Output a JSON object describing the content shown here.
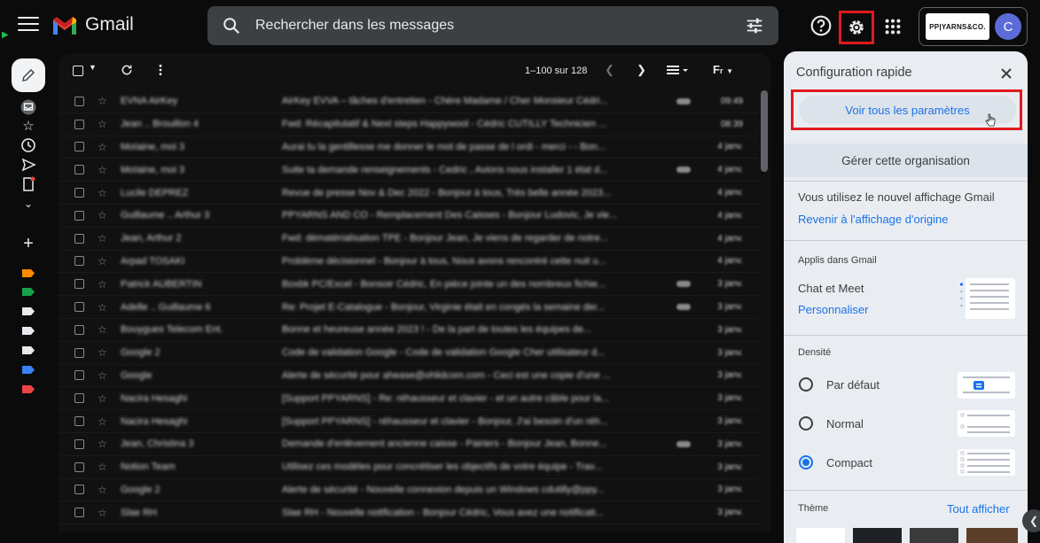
{
  "app": {
    "name": "Gmail"
  },
  "search": {
    "placeholder": "Rechercher dans les messages"
  },
  "account": {
    "org_logo_text": "PP|YARNS&CO.",
    "avatar_letter": "C"
  },
  "toolbar": {
    "pager": "1–100 sur 128"
  },
  "emails": [
    {
      "sender": "EVNA AirKey",
      "subject": "AirKey EVVA – tâches d'entretien - Chère Madame / Cher Monsieur Cédri...",
      "date": "09:49",
      "attach": true
    },
    {
      "sender": "Jean .. Brouillon 4",
      "subject": "Fwd: Récapitulatif & Next steps Happywool - Cédric CUTILLY Technicien ...",
      "date": "08:39",
      "attach": false
    },
    {
      "sender": "Moïaine, moi 3",
      "subject": "Aurai tu la gentillesse me donner le mot de passe de l ordi - merci - - Bon...",
      "date": "4 janv.",
      "attach": false
    },
    {
      "sender": "Moïaine, moi 3",
      "subject": "Suite ta demande renseignements - Cedric , Avions nous installer 1 état d...",
      "date": "4 janv.",
      "attach": true
    },
    {
      "sender": "Lucile DEPREZ",
      "subject": "Revue de presse Nov & Dec 2022 - Bonjour à tous, Très belle année 2023...",
      "date": "4 janv.",
      "attach": false
    },
    {
      "sender": "Guillaume .. Arthur 3",
      "subject": "PPYARNS AND CO - Remplacement Des Caisses - Bonjour Ludovic, Je vie...",
      "date": "4 janv.",
      "attach": false
    },
    {
      "sender": "Jean, Arthur 2",
      "subject": "Fwd: dématérialisation TPE - Bonjour Jean, Je viens de regarder de notre...",
      "date": "4 janv.",
      "attach": false
    },
    {
      "sender": "Arpad TOSAKI",
      "subject": "Problème décisionnel - Bonjour à tous, Nous avons rencontré cette nuit u...",
      "date": "4 janv.",
      "attach": false
    },
    {
      "sender": "Patrick AUBERTIN",
      "subject": "Boxbk PC/Excel - Bonsoir Cédric, En pièce jointe un des nombreux fichie...",
      "date": "3 janv.",
      "attach": true
    },
    {
      "sender": "Adelle .. Guillaume 6",
      "subject": "Re: Projet E-Catalogue - Bonjour, Virginie était en congés la semaine der...",
      "date": "3 janv.",
      "attach": true
    },
    {
      "sender": "Bouygues Telecom Ent.",
      "subject": "Bonne et heureuse année 2023 ! - De la part de toutes les équipes de...",
      "date": "3 janv.",
      "attach": false
    },
    {
      "sender": "Google 2",
      "subject": "Code de validation Google - Code de validation Google Cher utilisateur d...",
      "date": "3 janv.",
      "attach": false
    },
    {
      "sender": "Google",
      "subject": "Alerte de sécurité pour ahease@ohlidcom.com - Ceci est une copie d'une ...",
      "date": "3 janv.",
      "attach": false
    },
    {
      "sender": "Nacira Hesaghi",
      "subject": "[Support PPYARNS] - Re: réhausseur et clavier - et un autre câble pour la...",
      "date": "3 janv.",
      "attach": false
    },
    {
      "sender": "Nacira Hesaghi",
      "subject": "[Support PPYARNS] - réhausseur et clavier - Bonjour, J'ai besoin d'un réh...",
      "date": "3 janv.",
      "attach": false
    },
    {
      "sender": "Jean, Christina 3",
      "subject": "Demande d'enlèvement ancienne caisse - Pairiers - Bonjour Jean, Bonne...",
      "date": "3 janv.",
      "attach": true
    },
    {
      "sender": "Notion Team",
      "subject": "Utilisez ces modèles pour concrétiser les objectifs de votre équipe - Trav...",
      "date": "3 janv.",
      "attach": false
    },
    {
      "sender": "Google 2",
      "subject": "Alerte de sécurité - Nouvelle connexion depuis un Windows cdutilly@ppy...",
      "date": "3 janv.",
      "attach": false
    },
    {
      "sender": "Slae RH",
      "subject": "Slae RH - Nouvelle notification - Bonjour Cédric, Vous avez une notificati...",
      "date": "3 janv.",
      "attach": false
    }
  ],
  "panel": {
    "title": "Configuration rapide",
    "all_settings": "Voir tous les paramètres",
    "manage_org": "Gérer cette organisation",
    "new_view_text": "Vous utilisez le nouvel affichage Gmail",
    "revert_link": "Revenir à l'affichage d'origine",
    "apps_section": "Applis dans Gmail",
    "chat_meet": "Chat et Meet",
    "customize_link": "Personnaliser",
    "density_section": "Densité",
    "density_default": "Par défaut",
    "density_normal": "Normal",
    "density_compact": "Compact",
    "theme_section": "Thème",
    "show_all_link": "Tout afficher"
  },
  "colors": {
    "highlight_box": "#e0191e",
    "link_blue": "#1a73e8",
    "avatar_bg": "#5b6bd8"
  }
}
